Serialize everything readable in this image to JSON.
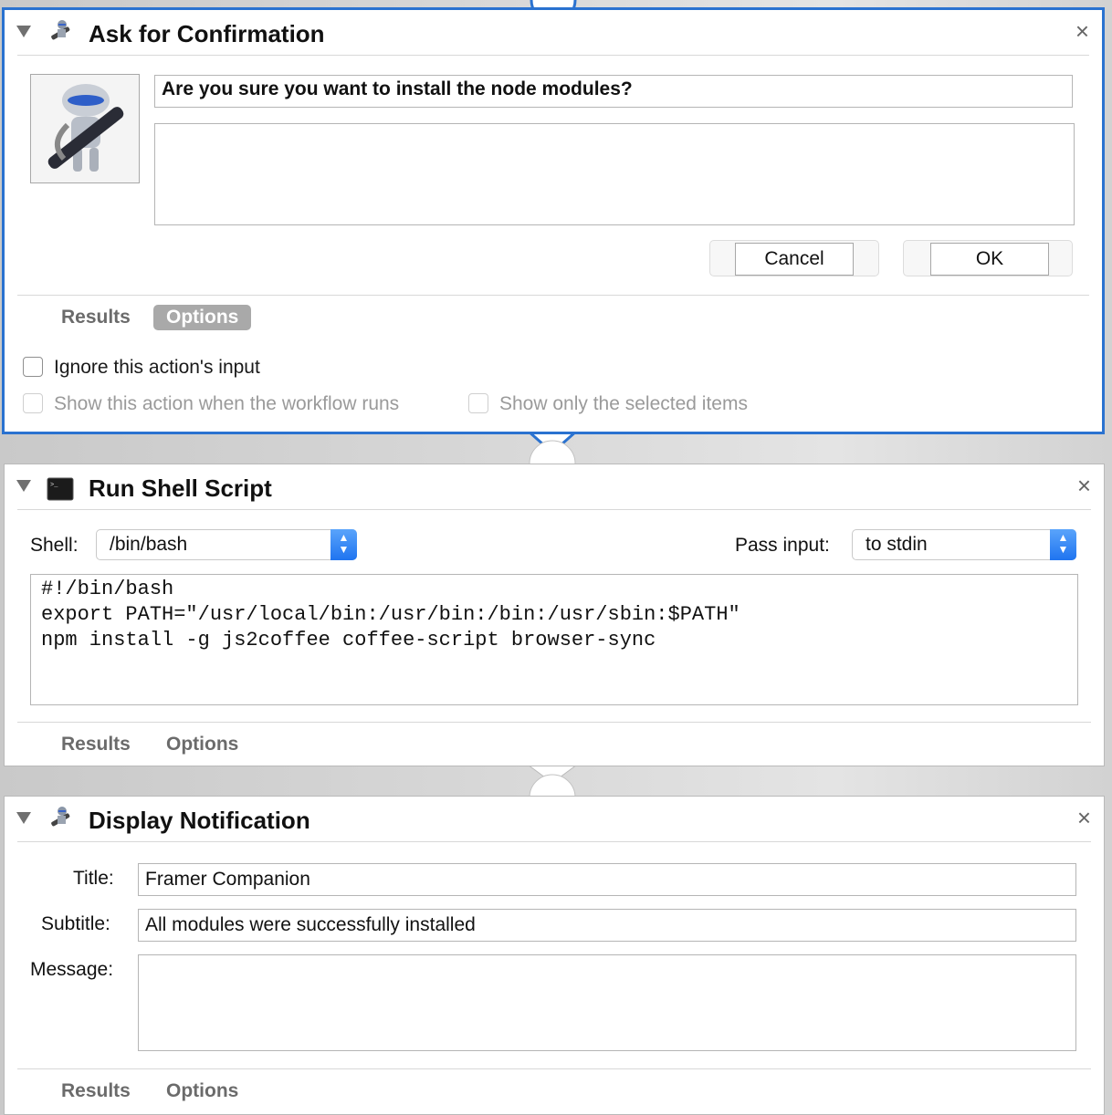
{
  "colors": {
    "selection": "#2a72d0",
    "stepper": "#2f7ff2",
    "active_tab_bg": "#a9a9a9"
  },
  "actions": [
    {
      "title": "Ask for Confirmation",
      "icon": "automator-robot-icon",
      "message": "Are you sure you want to install the node modules?",
      "detail": "",
      "cancel_label": "Cancel",
      "ok_label": "OK",
      "tabs": [
        "Results",
        "Options"
      ],
      "active_tab": "Options",
      "options": {
        "ignore_input": "Ignore this action's input",
        "show_when_runs": "Show this action when the workflow runs",
        "show_selected_only": "Show only the selected items"
      }
    },
    {
      "title": "Run Shell Script",
      "icon": "terminal-icon",
      "shell_label": "Shell:",
      "shell_value": "/bin/bash",
      "pass_input_label": "Pass input:",
      "pass_input_value": "to stdin",
      "script_lines": [
        "#!/bin/bash",
        "export PATH=\"/usr/local/bin:/usr/bin:/bin:/usr/sbin:$PATH\"",
        "npm install -g js2coffee coffee-script browser-sync"
      ],
      "tabs": [
        "Results",
        "Options"
      ]
    },
    {
      "title": "Display Notification",
      "icon": "automator-robot-icon",
      "title_label": "Title:",
      "title_value": "Framer Companion",
      "subtitle_label": "Subtitle:",
      "subtitle_value": "All modules were successfully installed",
      "message_label": "Message:",
      "message_value": "",
      "tabs": [
        "Results",
        "Options"
      ]
    }
  ],
  "close_symbol": "×"
}
